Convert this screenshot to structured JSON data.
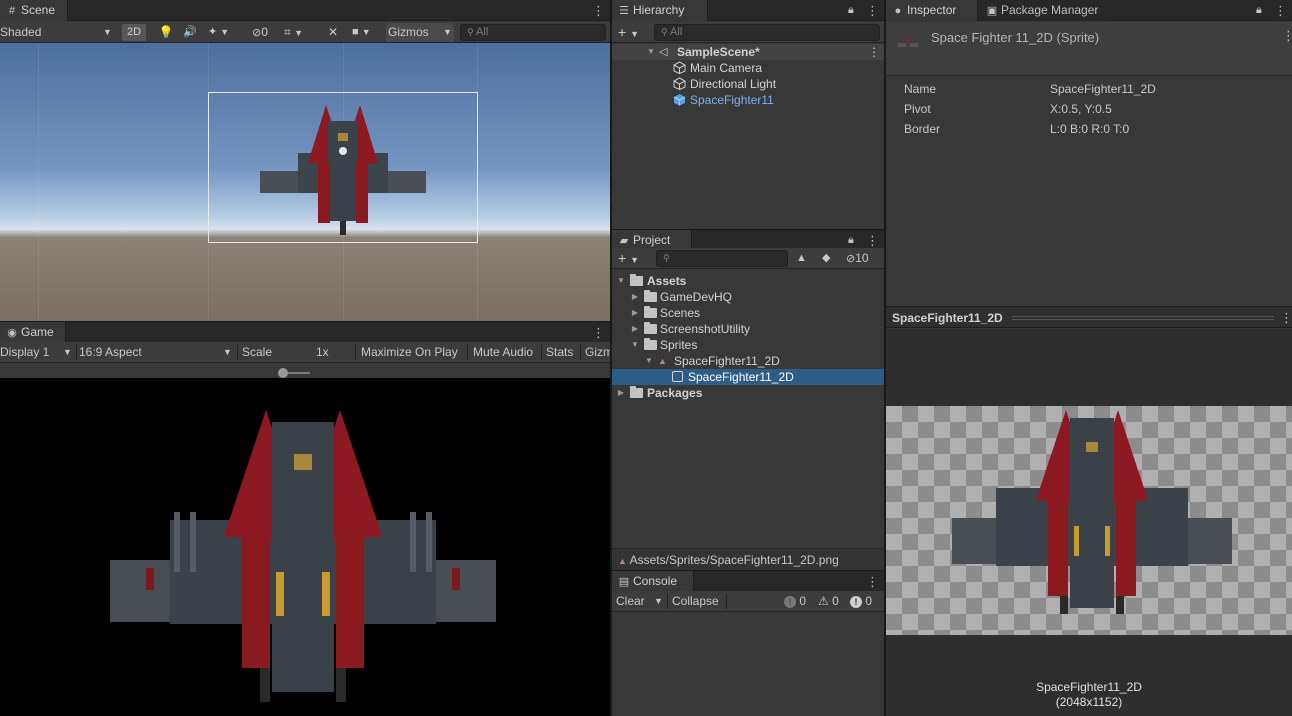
{
  "scene": {
    "tab": "Scene",
    "shading_mode": "Shaded",
    "btn_2d": "2D",
    "hidden_count": "0",
    "gizmos": "Gizmos",
    "search_placeholder": "All"
  },
  "game": {
    "tab": "Game",
    "display": "Display 1",
    "aspect": "16:9 Aspect",
    "scale_label": "Scale",
    "scale_value": "1x",
    "maximize": "Maximize On Play",
    "mute": "Mute Audio",
    "stats": "Stats",
    "gizmos": "Gizm"
  },
  "hierarchy": {
    "tab": "Hierarchy",
    "search_placeholder": "All",
    "scene_name": "SampleScene*",
    "items": [
      "Main Camera",
      "Directional Light",
      "SpaceFighter11"
    ]
  },
  "project": {
    "tab": "Project",
    "hidden_count": "10",
    "assets_label": "Assets",
    "folders": [
      "GameDevHQ",
      "Scenes",
      "ScreenshotUtility",
      "Sprites"
    ],
    "sprite_asset": "SpaceFighter11_2D",
    "sprite_child": "SpaceFighter11_2D",
    "packages_label": "Packages",
    "path": "Assets/Sprites/SpaceFighter11_2D.png"
  },
  "console": {
    "tab": "Console",
    "clear": "Clear",
    "collapse": "Collapse",
    "info_count": "0",
    "warn_count": "0",
    "error_count": "0"
  },
  "inspector": {
    "tab": "Inspector",
    "tab2": "Package Manager",
    "title": "Space Fighter 11_2D (Sprite)",
    "name_label": "Name",
    "name_value": "SpaceFighter11_2D",
    "pivot_label": "Pivot",
    "pivot_value": "X:0.5, Y:0.5",
    "border_label": "Border",
    "border_value": "L:0 B:0 R:0 T:0",
    "preview_header": "SpaceFighter11_2D",
    "preview_name": "SpaceFighter11_2D",
    "preview_size": "(2048x1152)"
  },
  "colors": {
    "selection": "#2c5d87",
    "accent_blue": "#7cb2f0",
    "panel": "#383838"
  }
}
